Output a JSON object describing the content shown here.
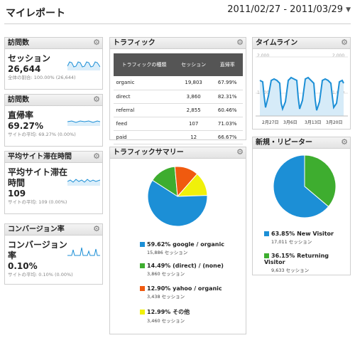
{
  "header": {
    "title": "マイレポート",
    "date_range": "2011/02/27 - 2011/03/29"
  },
  "widgets": {
    "visits": {
      "title": "訪問数",
      "label": "セッション",
      "value": "26,644",
      "sub": "全体の割合: 100.00% (26,644)"
    },
    "bounce": {
      "title": "訪問数",
      "label": "直帰率",
      "value": "69.27%",
      "sub": "サイトの平均: 69.27% (0.00%)"
    },
    "avg_time": {
      "title": "平均サイト滞在時間",
      "label_line1": "平均サイト滞在",
      "label_line2": "時間",
      "value": "109",
      "sub": "サイトの平均: 109 (0.00%)"
    },
    "conversion": {
      "title": "コンバージョン率",
      "label_line1": "コンバージョン",
      "label_line2": "率",
      "value": "0.10%",
      "sub": "サイトの平均: 0.10% (0.00%)"
    },
    "traffic": {
      "title": "トラフィック",
      "columns": [
        "トラフィックの種類",
        "セッション",
        "直帰率"
      ],
      "rows": [
        [
          "organic",
          "19,803",
          "67.99%"
        ],
        [
          "direct",
          "3,860",
          "82.31%"
        ],
        [
          "referral",
          "2,855",
          "60.46%"
        ],
        [
          "feed",
          "107",
          "71.03%"
        ],
        [
          "paid",
          "12",
          "66.67%"
        ]
      ]
    },
    "traffic_summary": {
      "title": "トラフィックサマリー",
      "items": [
        {
          "label": "59.62% google / organic",
          "sub": "15,886 セッション",
          "color": "#1c8fd6"
        },
        {
          "label": "14.49% (direct) / (none)",
          "sub": "3,860 セッション",
          "color": "#3ead2f"
        },
        {
          "label": "12.90% yahoo / organic",
          "sub": "3,438 セッション",
          "color": "#f05a0f"
        },
        {
          "label": "12.99% その他",
          "sub": "3,460 セッション",
          "color": "#f0f00a"
        }
      ]
    },
    "timeline": {
      "title": "タイムライン",
      "y_top": "2,000",
      "y_mid": "1,000",
      "y_top2": "2,000",
      "y_mid2": "1,000",
      "x_labels": [
        "2月27日",
        "3月6日",
        "3月13日",
        "3月20日"
      ]
    },
    "new_returning": {
      "title": "新規・リピーター",
      "items": [
        {
          "label": "63.85% New Visitor",
          "sub": "17,011 セッション",
          "color": "#1c8fd6"
        },
        {
          "label": "36.15% Returning Visitor",
          "sub": "9,633 セッション",
          "color": "#3ead2f"
        }
      ]
    }
  },
  "chart_data": [
    {
      "type": "pie",
      "title": "トラフィックサマリー",
      "categories": [
        "google / organic",
        "(direct) / (none)",
        "yahoo / organic",
        "その他"
      ],
      "values": [
        59.62,
        14.49,
        12.9,
        12.99
      ],
      "colors": [
        "#1c8fd6",
        "#3ead2f",
        "#f05a0f",
        "#f0f00a"
      ]
    },
    {
      "type": "pie",
      "title": "新規・リピーター",
      "categories": [
        "New Visitor",
        "Returning Visitor"
      ],
      "values": [
        63.85,
        36.15
      ],
      "colors": [
        "#1c8fd6",
        "#3ead2f"
      ]
    }
  ]
}
